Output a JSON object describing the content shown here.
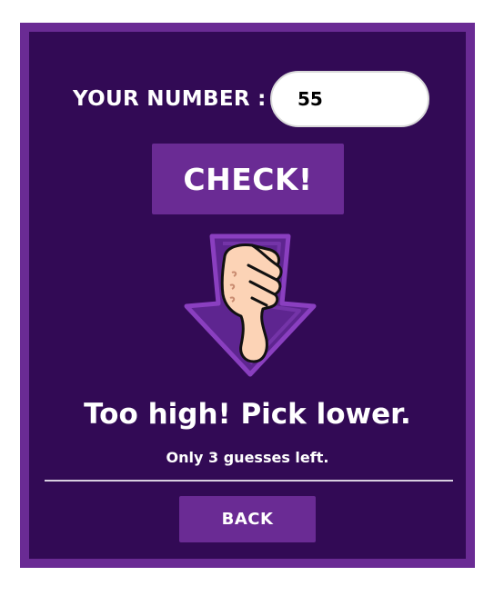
{
  "game": {
    "number_label": "YOUR NUMBER :",
    "number_value": "55",
    "check_label": "CHECK!",
    "feedback_icon": "thumbs-down-arrow-icon",
    "result_text": "Too high! Pick lower.",
    "guesses_text": "Only 3 guesses left.",
    "back_label": "BACK"
  },
  "colors": {
    "frame": "#6a2b94",
    "panel": "#320a55",
    "button": "#6a2b94",
    "text": "#ffffff",
    "arrow": "#5e2590",
    "arrow_outline": "#8a3fc0",
    "hand_skin": "#fcd3b6"
  }
}
